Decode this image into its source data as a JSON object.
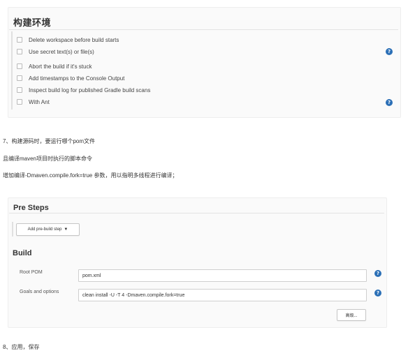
{
  "build_env": {
    "title": "构建环境",
    "options": [
      {
        "label": "Delete workspace before build starts",
        "checked": false
      },
      {
        "label": "Use secret text(s) or file(s)",
        "checked": false
      },
      {
        "label": "Abort the build if it's stuck",
        "checked": false
      },
      {
        "label": "Add timestamps to the Console Output",
        "checked": false
      },
      {
        "label": "Inspect build log for published Gradle build scans",
        "checked": false
      },
      {
        "label": "With Ant",
        "checked": false
      }
    ],
    "help_glyph": "?"
  },
  "notes": {
    "step7": "7、构建源码时，要运行哪个pom文件",
    "line2": "且编译maven项目时执行的脚本命令",
    "line3": "增加编译-Dmaven.compile.fork=true 参数，用以指明多线程进行编译；",
    "step8": "8、应用，保存"
  },
  "pre_steps": {
    "title": "Pre Steps",
    "add_button": "Add pre-build step"
  },
  "build": {
    "title": "Build",
    "root_pom_label": "Root POM",
    "root_pom_value": "pom.xml",
    "goals_label": "Goals and options",
    "goals_value": "clean install -U -T 4 -Dmaven.compile.fork=true",
    "advanced_button": "高级...",
    "help_glyph": "?"
  },
  "colors": {
    "help_icon": "#2b6fb6",
    "panel_bg": "#fafafa"
  }
}
